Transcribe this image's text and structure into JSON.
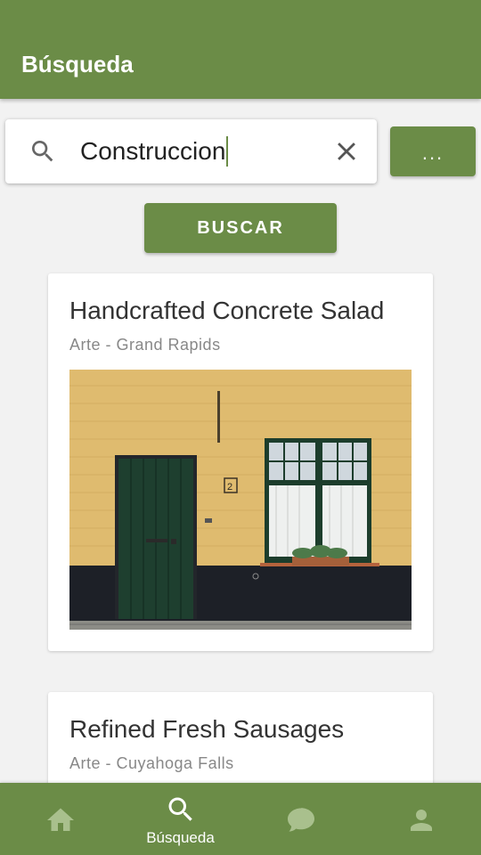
{
  "app_bar": {
    "title": "Búsqueda"
  },
  "search": {
    "value": "Construccion",
    "clear_icon": "close-icon",
    "search_icon": "search-icon"
  },
  "buttons": {
    "more_label": "...",
    "search_label": "BUSCAR"
  },
  "results": [
    {
      "title": "Handcrafted Concrete Salad",
      "subtitle": "Arte - Grand Rapids",
      "image": "yellow-brick-house-with-green-door-photo"
    },
    {
      "title": "Refined Fresh Sausages",
      "subtitle": "Arte - Cuyahoga Falls"
    }
  ],
  "bottom_nav": {
    "items": [
      {
        "icon": "home-icon",
        "label": "",
        "active": false
      },
      {
        "icon": "search-icon",
        "label": "Búsqueda",
        "active": true
      },
      {
        "icon": "chat-icon",
        "label": "",
        "active": false
      },
      {
        "icon": "person-icon",
        "label": "",
        "active": false
      }
    ]
  },
  "colors": {
    "primary": "#6b8c47",
    "background": "#f2f2f2",
    "inactive_icon": "#a9c08d",
    "active_icon": "#ffffff"
  }
}
